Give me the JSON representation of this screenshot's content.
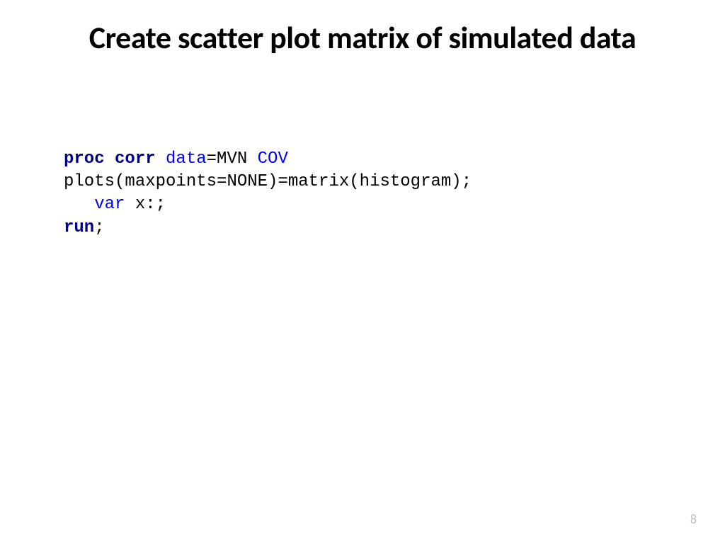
{
  "slide": {
    "title": "Create scatter plot matrix of simulated data",
    "page_number": "8"
  },
  "code": {
    "l1_proc": "proc ",
    "l1_corr": "corr ",
    "l1_data": "data",
    "l1_eqmvn": "=MVN ",
    "l1_cov": "COV",
    "l2": "plots(maxpoints=NONE)=matrix(histogram);",
    "l3_indent": "   ",
    "l3_var": "var",
    "l3_rest": " x:;",
    "l4_run": "run",
    "l4_semi": ";"
  }
}
